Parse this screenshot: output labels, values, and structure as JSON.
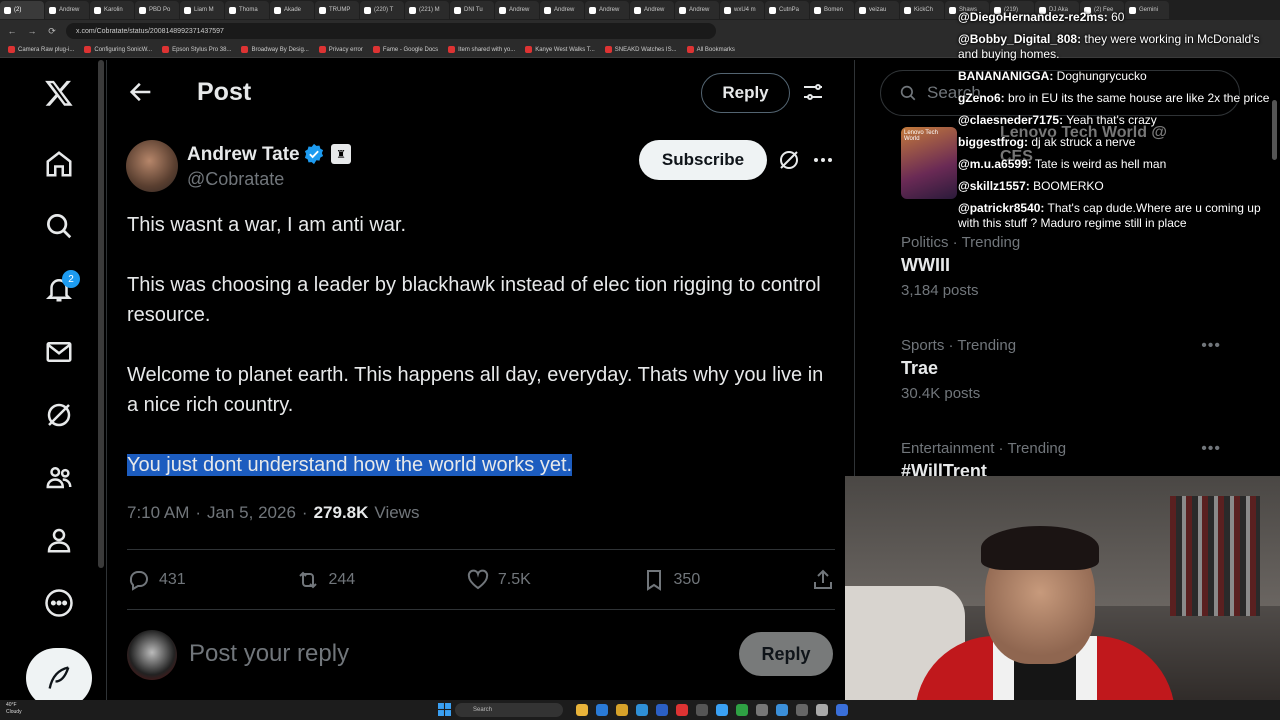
{
  "browser": {
    "tabs": [
      "(2)",
      "Andrew",
      "Karolin",
      "PBD Po",
      "Liam M",
      "Thoma",
      "Akade",
      "TRUMP",
      "(220) T",
      "(221) M",
      "DNI Tu",
      "Andrew",
      "Andrew",
      "Andrew",
      "Andrew",
      "Andrew",
      "wxU4 m",
      "CutnPa",
      "Bomen",
      "veizau",
      "KickCh",
      "Shaws",
      "(219)",
      "DJ Aka",
      "(2) Fee",
      "Gemini"
    ],
    "url": "x.com/Cobratate/status/2008148992371437597",
    "bookmarks": [
      "Camera Raw plug-i...",
      "Configuring SonicW...",
      "Epson Stylus Pro 38...",
      "Broadway By Desig...",
      "Privacy error",
      "Fame - Google Docs",
      "Item shared with yo...",
      "Kanye West Walks T...",
      "SNEAKD Watches IS...",
      "All Bookmarks"
    ]
  },
  "nav": {
    "notifications_badge": "2"
  },
  "header": {
    "title": "Post",
    "reply_label": "Reply"
  },
  "post": {
    "author_name": "Andrew Tate",
    "handle": "@Cobratate",
    "subscribe_label": "Subscribe",
    "paragraphs": [
      "This wasnt a war, I am anti war.",
      "This was choosing a leader by blackhawk instead of elec tion rigging to control resource.",
      "Welcome to planet earth. This happens all day, everyday. Thats why you live in a nice rich country."
    ],
    "highlighted": "You just dont understand how the world works yet.",
    "time": "7:10 AM",
    "date": "Jan 5, 2026",
    "views_count": "279.8K",
    "views_label": "Views",
    "replies": "431",
    "reposts": "244",
    "likes": "7.5K",
    "bookmarks": "350"
  },
  "composer": {
    "placeholder": "Post your reply",
    "button": "Reply"
  },
  "sidebar": {
    "search_placeholder": "Search",
    "promo_title": "Lenovo Tech World @",
    "promo_sub": "CES",
    "trends": [
      {
        "category": "Politics · Trending",
        "name": "WWIII",
        "count": "3,184 posts"
      },
      {
        "category": "Sports · Trending",
        "name": "Trae",
        "count": "30.4K posts"
      },
      {
        "category": "Entertainment · Trending",
        "name": "#WillTrent",
        "count": ""
      }
    ]
  },
  "chat": [
    {
      "user": "@DiegoHernandez-re2ms:",
      "text": "60"
    },
    {
      "user": "@Bobby_Digital_808:",
      "text": "they were working in McDonald's and buying homes."
    },
    {
      "user": "BANANANIGGA:",
      "text": "Doghungrycucko"
    },
    {
      "user": "gZeno6:",
      "text": "bro in EU its the same house are like 2x the price"
    },
    {
      "user": "@claesneder7175:",
      "text": "Yeah that's crazy"
    },
    {
      "user": "biggestfrog:",
      "text": "dj ak struck a nerve"
    },
    {
      "user": "@m.u.a6599:",
      "text": "Tate is weird as hell man"
    },
    {
      "user": "@skillz1557:",
      "text": "BOOMERKO"
    },
    {
      "user": "@patrickr8540:",
      "text": "That's cap dude.Where are u coming up with this stuff ? Maduro regime still in place"
    }
  ],
  "taskbar": {
    "weather_temp": "40°F",
    "weather_desc": "Cloudy",
    "search_label": "Search"
  }
}
